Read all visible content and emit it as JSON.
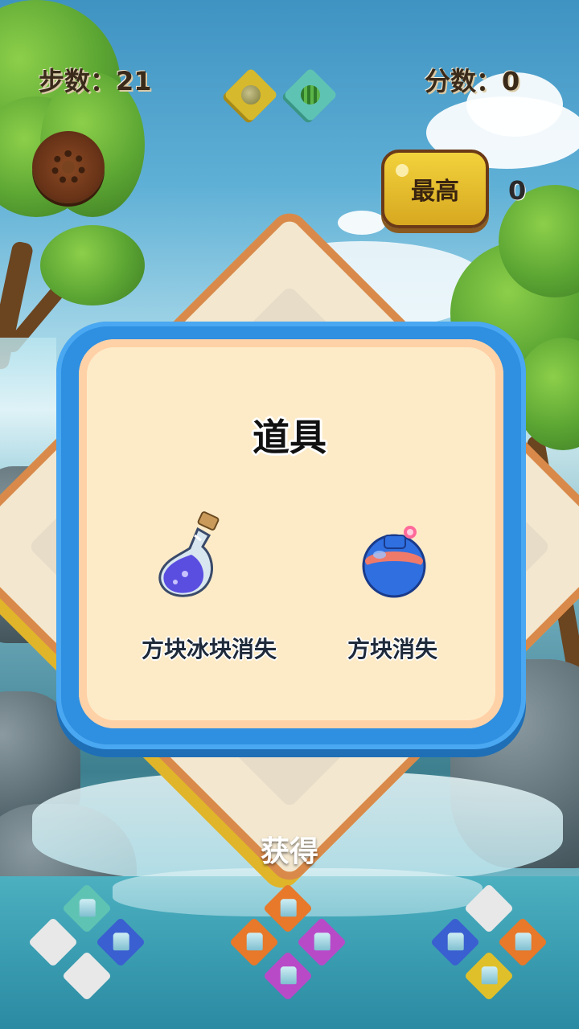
{
  "hud": {
    "steps_label": "步数：21",
    "score_label": "分数：0",
    "best_label": "最高",
    "best_value": "0"
  },
  "target_tiles": [
    {
      "icon": "coconut-icon",
      "color": "#d6b92c"
    },
    {
      "icon": "watermelon-icon",
      "color": "#5fc3b3"
    }
  ],
  "dialog": {
    "title": "道具",
    "items": [
      {
        "icon": "potion-bottle-icon",
        "label": "方块冰块消失"
      },
      {
        "icon": "bomb-icon",
        "label": "方块消失"
      }
    ]
  },
  "obtain_label": "获得",
  "colors": {
    "panel_border": "#2f8fe0",
    "panel_fill": "#fdebc8",
    "best_button": "#f2d23c"
  }
}
